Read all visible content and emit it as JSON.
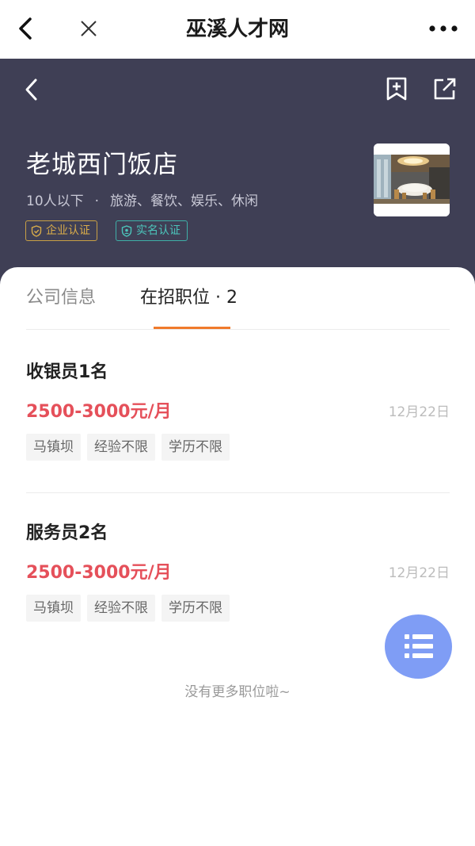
{
  "topbar": {
    "title": "巫溪人才网"
  },
  "company": {
    "name": "老城西门饭店",
    "size": "10人以下",
    "separator": "·",
    "industry": "旅游、餐饮、娱乐、休闲",
    "badges": [
      {
        "label": "企业认证",
        "icon": "shield-check-icon",
        "color": "#d9ac4a"
      },
      {
        "label": "实名认证",
        "icon": "shield-user-icon",
        "color": "#4cc5bb"
      }
    ]
  },
  "tabs": [
    {
      "label": "公司信息"
    },
    {
      "label": "在招职位 · 2"
    }
  ],
  "jobs": [
    {
      "title": "收银员1名",
      "salary": "2500-3000元/月",
      "date": "12月22日",
      "tags": [
        "马镇坝",
        "经验不限",
        "学历不限"
      ]
    },
    {
      "title": "服务员2名",
      "salary": "2500-3000元/月",
      "date": "12月22日",
      "tags": [
        "马镇坝",
        "经验不限",
        "学历不限"
      ]
    }
  ],
  "footer": {
    "no_more": "没有更多职位啦~"
  },
  "colors": {
    "header_bg": "#3f3f55",
    "salary": "#e5505a",
    "tab_accent": "#f07a2c",
    "fab": "#7f9df5"
  }
}
